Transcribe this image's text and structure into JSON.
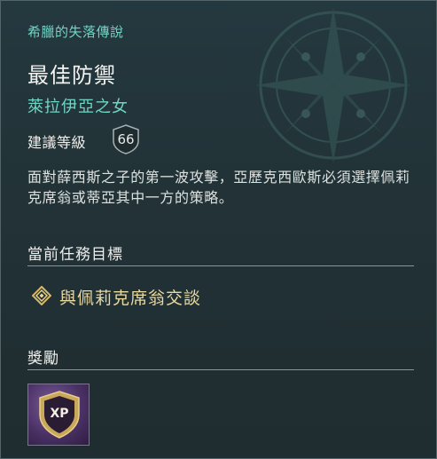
{
  "quest": {
    "questline": "希臘的失落傳說",
    "title": "最佳防禦",
    "subtitle": "萊拉伊亞之女",
    "recommended_level_label": "建議等級",
    "recommended_level": "66",
    "description": "面對薛西斯之子的第一波攻擊，亞歷克西歐斯必須選擇佩莉克席翁或蒂亞其中一方的策略。"
  },
  "objectives": {
    "header": "當前任務目標",
    "items": [
      {
        "label": "與佩莉克席翁交談",
        "icon": "quest-diamond-icon"
      }
    ]
  },
  "rewards": {
    "header": "獎勵",
    "items": [
      {
        "label": "XP",
        "icon": "xp-shield-icon"
      }
    ]
  },
  "colors": {
    "accent_teal": "#6fd6c6",
    "objective_gold": "#e8d9a0",
    "panel_bg": "#223236"
  }
}
